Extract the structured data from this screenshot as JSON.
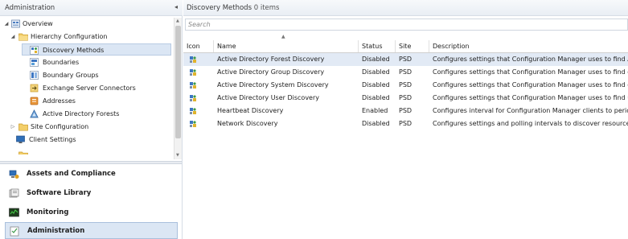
{
  "left_pane": {
    "title": "Administration",
    "collapse_glyph": "◂",
    "tree": [
      {
        "label": "Overview",
        "icon": "overview-icon",
        "arrow": "◢"
      },
      {
        "label": "Hierarchy Configuration",
        "icon": "folder-open-icon",
        "arrow": "◢"
      },
      {
        "label": "Discovery Methods",
        "icon": "discovery-methods-icon",
        "selected": true
      },
      {
        "label": "Boundaries",
        "icon": "boundaries-icon"
      },
      {
        "label": "Boundary Groups",
        "icon": "boundary-groups-icon"
      },
      {
        "label": "Exchange Server Connectors",
        "icon": "exchange-connector-icon"
      },
      {
        "label": "Addresses",
        "icon": "addresses-icon"
      },
      {
        "label": "Active Directory Forests",
        "icon": "ad-forests-icon"
      },
      {
        "label": "Site Configuration",
        "icon": "folder-icon",
        "arrow": "▷"
      },
      {
        "label": "Client Settings",
        "icon": "client-settings-icon"
      }
    ],
    "workspaces": [
      {
        "label": "Assets and Compliance",
        "icon": "assets-compliance-icon"
      },
      {
        "label": "Software Library",
        "icon": "software-library-icon"
      },
      {
        "label": "Monitoring",
        "icon": "monitoring-icon"
      },
      {
        "label": "Administration",
        "icon": "administration-icon",
        "selected": true
      }
    ]
  },
  "right_pane": {
    "title": "Discovery Methods",
    "count_label": "0 items",
    "search_placeholder": "Search",
    "columns": [
      "Icon",
      "Name",
      "Status",
      "Site",
      "Description"
    ],
    "rows": [
      {
        "name": "Active Directory Forest Discovery",
        "status": "Disabled",
        "site": "PSD",
        "description": "Configures settings that Configuration Manager uses to find Active...",
        "selected": true
      },
      {
        "name": "Active Directory Group Discovery",
        "status": "Disabled",
        "site": "PSD",
        "description": "Configures settings that Configuration Manager uses to find groups"
      },
      {
        "name": "Active Directory System Discovery",
        "status": "Disabled",
        "site": "PSD",
        "description": "Configures settings that Configuration Manager uses to find comput"
      },
      {
        "name": "Active Directory User Discovery",
        "status": "Disabled",
        "site": "PSD",
        "description": "Configures settings that Configuration Manager uses to find user ac"
      },
      {
        "name": "Heartbeat Discovery",
        "status": "Enabled",
        "site": "PSD",
        "description": "Configures interval for Configuration Manager clients to periodically"
      },
      {
        "name": "Network Discovery",
        "status": "Disabled",
        "site": "PSD",
        "description": "Configures settings and polling intervals to discover resources on th"
      }
    ]
  },
  "colors": {
    "selection": "#dbe6f4",
    "header_bg": "#eef2f7",
    "folder": "#f0c24b",
    "accent_blue": "#2b6cb0"
  }
}
